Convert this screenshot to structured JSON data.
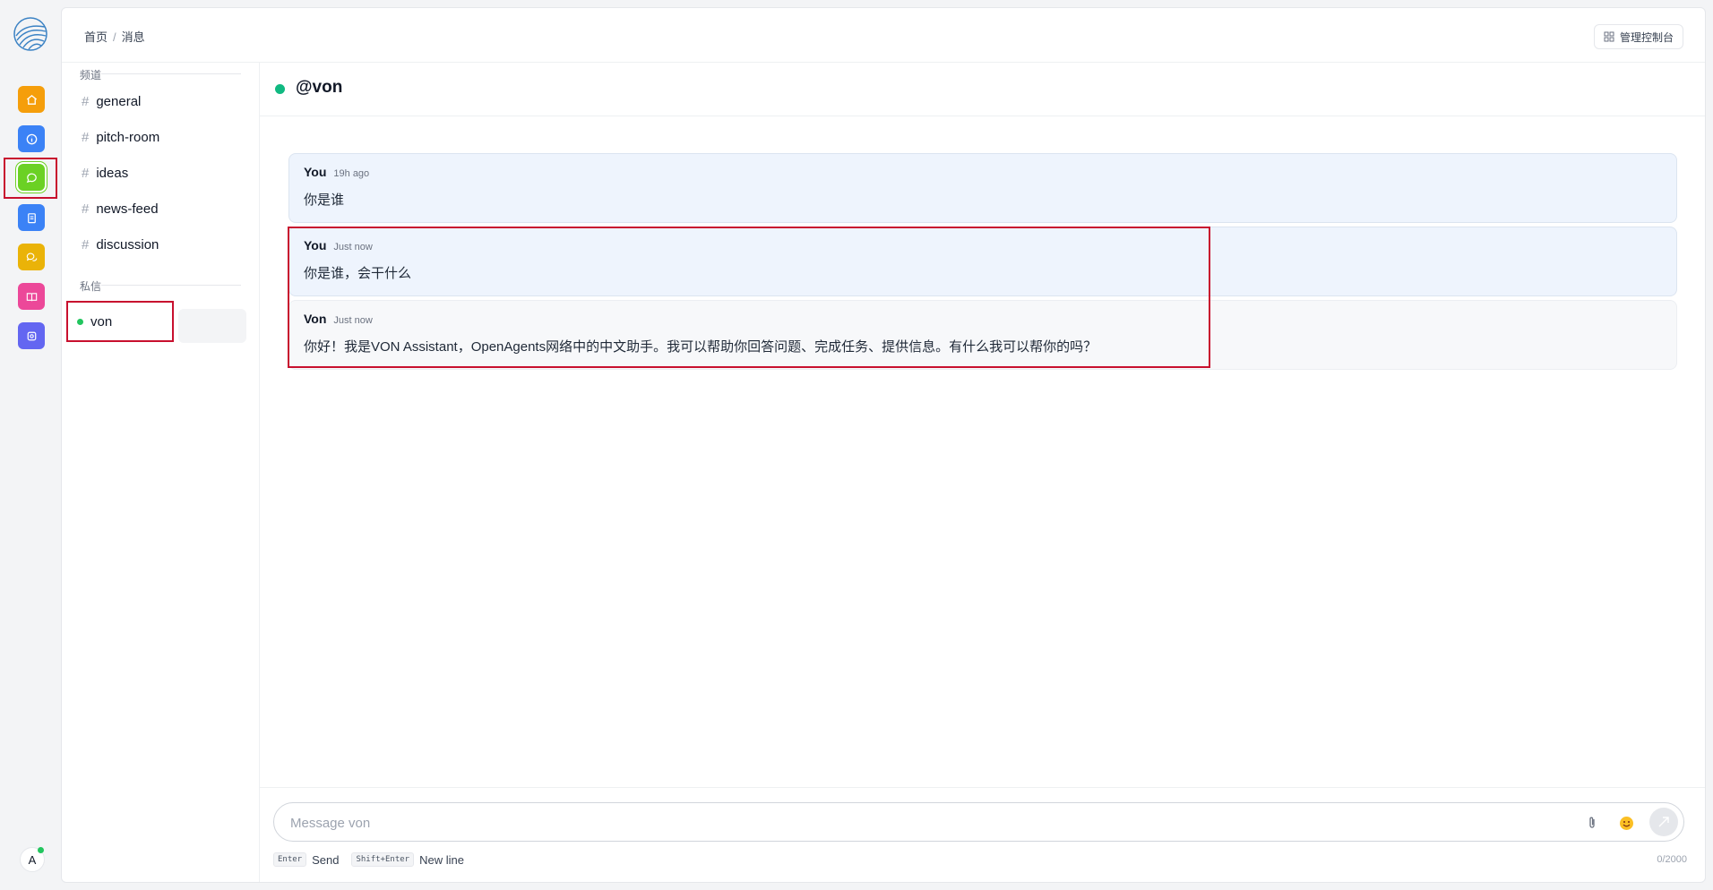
{
  "breadcrumb": {
    "home": "首页",
    "separator": "/",
    "current": "消息"
  },
  "header": {
    "admin_label": "管理控制台"
  },
  "rail": {
    "items": [
      {
        "icon": "home-icon",
        "color": "#f59e0b"
      },
      {
        "icon": "info-icon",
        "color": "#3b82f6"
      },
      {
        "icon": "chat-bubble-icon",
        "color": "#6bd124"
      },
      {
        "icon": "clipboard-icon",
        "color": "#3b82f6"
      },
      {
        "icon": "forum-icon",
        "color": "#eab308"
      },
      {
        "icon": "book-icon",
        "color": "#ec4899"
      },
      {
        "icon": "agent-icon",
        "color": "#6366f1"
      }
    ],
    "avatar": "A"
  },
  "sidebar": {
    "channels_label": "频道",
    "channels": [
      "general",
      "pitch-room",
      "ideas",
      "news-feed",
      "discussion"
    ],
    "dm_label": "私信",
    "dms": [
      {
        "name": "von",
        "status": "online"
      }
    ]
  },
  "chat": {
    "title": "@von",
    "messages": [
      {
        "author": "You",
        "time": "19h ago",
        "text": "你是谁"
      },
      {
        "author": "You",
        "time": "Just now",
        "text": "你是谁，会干什么"
      },
      {
        "author": "Von",
        "time": "Just now",
        "text": "你好！我是VON Assistant，OpenAgents网络中的中文助手。我可以帮助你回答问题、完成任务、提供信息。有什么我可以帮你的吗？"
      }
    ]
  },
  "composer": {
    "placeholder": "Message von",
    "hints": [
      {
        "key": "Enter",
        "label": "Send"
      },
      {
        "key": "Shift+Enter",
        "label": "New line"
      }
    ],
    "counter": "0/2000"
  },
  "colors": {
    "online": "#22c55e",
    "highlight": "#c8102e",
    "accent": "#6bd124"
  }
}
